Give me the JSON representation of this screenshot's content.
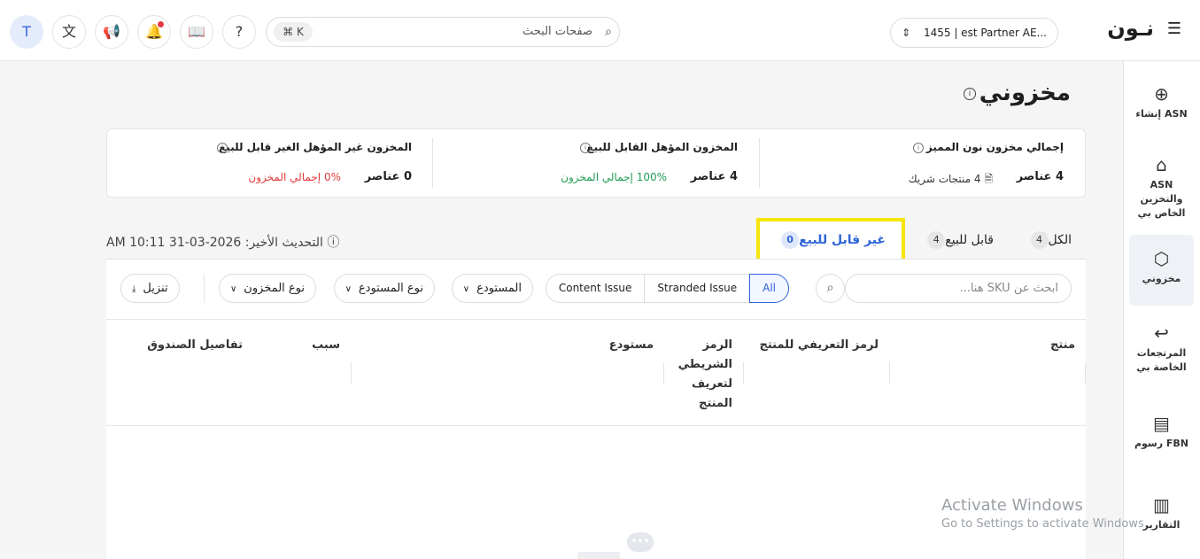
{
  "topbar": {
    "logo": "نـون",
    "partner": "1455 | est Partner AE...",
    "search_placeholder": "صفحات البحث",
    "search_kbd": "⌘ K",
    "avatar_letter": "T"
  },
  "sidebar": {
    "items": [
      {
        "label": "إنشاء ASN",
        "icon": "⊕"
      },
      {
        "label": "ASN والتخزين الخاص بي",
        "icon": "⌂"
      },
      {
        "label": "مخزوني",
        "icon": "⬡"
      },
      {
        "label": "المرتجعات الخاصة بي",
        "icon": "↩"
      },
      {
        "label": "رسوم FBN",
        "icon": "▤"
      },
      {
        "label": "التقارير",
        "icon": "▥"
      }
    ]
  },
  "page": {
    "title": "مخزوني"
  },
  "summary": {
    "total": {
      "heading": "إجمالي مخزون نون المميز",
      "value": "4 عناصر",
      "sub": "4 منتجات شريك"
    },
    "eligible": {
      "heading": "المخزون المؤهل القابل للبيع",
      "value": "4 عناصر",
      "sub": "100% إجمالي المخزون"
    },
    "ineligible": {
      "heading": "المخزون غير المؤهل الغير قابل للبيع",
      "value": "0 عناصر",
      "sub": "0% إجمالي المخزون"
    }
  },
  "tabs": {
    "all": {
      "label": "الكل",
      "count": "4"
    },
    "sellable": {
      "label": "قابل للبيع",
      "count": "4"
    },
    "unsellable": {
      "label": "غير قابل للبيع",
      "count": "0"
    },
    "last_update": "التحديث الأخير: 2026-03-31 10:11 AM"
  },
  "filters": {
    "sku_placeholder": "ابحث عن SKU هنا...",
    "segments": [
      "All",
      "Stranded Issue",
      "Content Issue"
    ],
    "warehouse": "المستودع",
    "warehouse_type": "نوع المستودع",
    "inventory_type": "نوع المخزون",
    "download": "تنزيل"
  },
  "table": {
    "headers": [
      "منتج",
      "لرمز التعريفي للمنتج",
      "الرمز الشريطي لتعريف المنتج",
      "مستودع",
      "سبب",
      "تفاصيل الصندوق"
    ]
  },
  "watermark": {
    "line1": "Activate Windows",
    "line2": "Go to Settings to activate Windows."
  },
  "colors": {
    "accent": "#2d64d8",
    "highlight": "#f5e50c",
    "positive": "#1f9d55",
    "negative": "#e03c3c"
  }
}
